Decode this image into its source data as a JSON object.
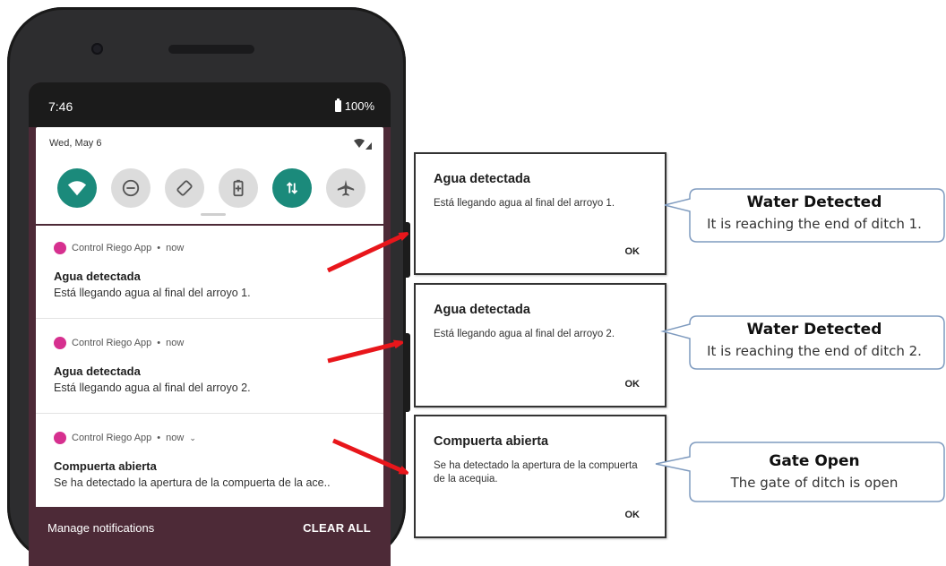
{
  "status_bar": {
    "time": "7:46",
    "battery": "100%"
  },
  "quick_settings": {
    "date": "Wed, May 6"
  },
  "notifications": [
    {
      "app": "Control Riego App",
      "when": "now",
      "title": "Agua detectada",
      "body": "Está llegando agua al final del arroyo 1."
    },
    {
      "app": "Control Riego App",
      "when": "now",
      "title": "Agua detectada",
      "body": "Está llegando agua al final del arroyo 2."
    },
    {
      "app": "Control Riego App",
      "when": "now",
      "title": "Compuerta abierta",
      "body": "Se ha detectado la apertura de la compuerta de la ace.."
    }
  ],
  "bottom_bar": {
    "manage": "Manage notifications",
    "clear_all": "CLEAR ALL"
  },
  "dialogs": [
    {
      "title": "Agua detectada",
      "body": "Está llegando agua al final del arroyo 1.",
      "ok": "OK"
    },
    {
      "title": "Agua detectada",
      "body": "Está llegando agua al final del arroyo 2.",
      "ok": "OK"
    },
    {
      "title": "Compuerta abierta",
      "body": "Se ha detectado la apertura de la compuerta de la acequia.",
      "ok": "OK"
    }
  ],
  "callouts": [
    {
      "title": "Water Detected",
      "subtitle": "It is reaching the end of ditch 1."
    },
    {
      "title": "Water Detected",
      "subtitle": "It is reaching the end of ditch 2."
    },
    {
      "title": "Gate Open",
      "subtitle": "The gate of ditch is open"
    }
  ],
  "colors": {
    "accent": "#1b8a7b",
    "app_icon": "#d6308f",
    "shade": "#4d2a37",
    "arrow": "#e8161b",
    "callout_border": "#7f9bbf"
  }
}
